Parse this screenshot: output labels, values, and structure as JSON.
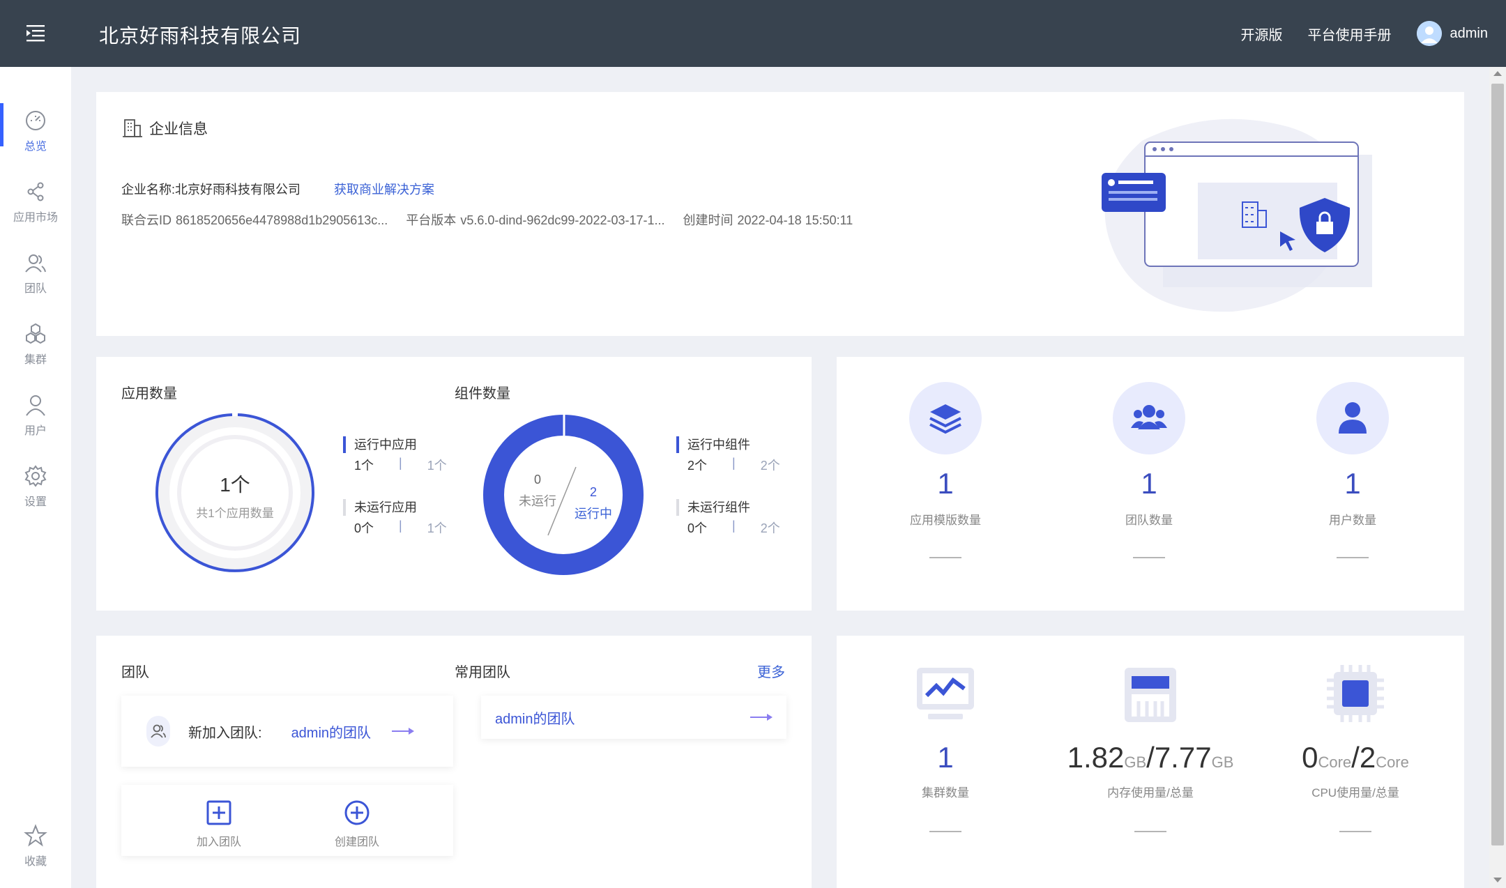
{
  "header": {
    "company_name": "北京好雨科技有限公司",
    "links": [
      "开源版",
      "平台使用手册"
    ],
    "user_name": "admin"
  },
  "sidebar": {
    "items": [
      {
        "label": "总览",
        "icon": "dashboard-icon"
      },
      {
        "label": "应用市场",
        "icon": "share-icon"
      },
      {
        "label": "团队",
        "icon": "team-icon"
      },
      {
        "label": "集群",
        "icon": "cluster-icon"
      },
      {
        "label": "用户",
        "icon": "user-icon"
      },
      {
        "label": "设置",
        "icon": "gear-icon"
      },
      {
        "label": "收藏",
        "icon": "star-icon"
      }
    ]
  },
  "enterprise": {
    "title": "企业信息",
    "name_label": "企业名称:",
    "name_value": "北京好雨科技有限公司",
    "solution_link": "获取商业解决方案",
    "cloud_id_label": "联合云ID",
    "cloud_id_value": "8618520656e4478988d1b2905613c...",
    "version_label": "平台版本",
    "version_value": "v5.6.0-dind-962dc99-2022-03-17-1...",
    "created_label": "创建时间",
    "created_value": "2022-04-18 15:50:11"
  },
  "apps": {
    "title": "应用数量",
    "center_value": "1个",
    "center_label": "共1个应用数量",
    "running_label": "运行中应用",
    "running_value": "1个",
    "running_total": "1个",
    "stopped_label": "未运行应用",
    "stopped_value": "0个",
    "stopped_total": "1个",
    "sep": "|"
  },
  "components": {
    "title": "组件数量",
    "stopped_count": "0",
    "stopped_text": "未运行",
    "running_count": "2",
    "running_text": "运行中",
    "running_label": "运行中组件",
    "running_value": "2个",
    "running_total": "2个",
    "stopped_label": "未运行组件",
    "stopped_value": "0个",
    "stopped_total": "2个",
    "sep": "|"
  },
  "stats": [
    {
      "value": "1",
      "label": "应用模版数量",
      "icon": "layers-icon"
    },
    {
      "value": "1",
      "label": "团队数量",
      "icon": "users-group-icon"
    },
    {
      "value": "1",
      "label": "用户数量",
      "icon": "user-solid-icon"
    }
  ],
  "teams": {
    "title": "团队",
    "new_label": "新加入团队:",
    "new_team": "admin的团队",
    "join_label": "加入团队",
    "create_label": "创建团队",
    "common_title": "常用团队",
    "more": "更多",
    "common_team": "admin的团队"
  },
  "resources": {
    "cluster_value": "1",
    "cluster_label": "集群数量",
    "mem_used": "1.82",
    "mem_unit": "GB",
    "mem_sep": "/",
    "mem_total": "7.77",
    "mem_label": "内存使用量/总量",
    "cpu_used": "0",
    "cpu_unit": "Core",
    "cpu_sep": "/",
    "cpu_total": "2",
    "cpu_label": "CPU使用量/总量"
  },
  "colors": {
    "header_bg": "#38434f",
    "accent": "#3b55d6",
    "link": "#3b62d6"
  }
}
